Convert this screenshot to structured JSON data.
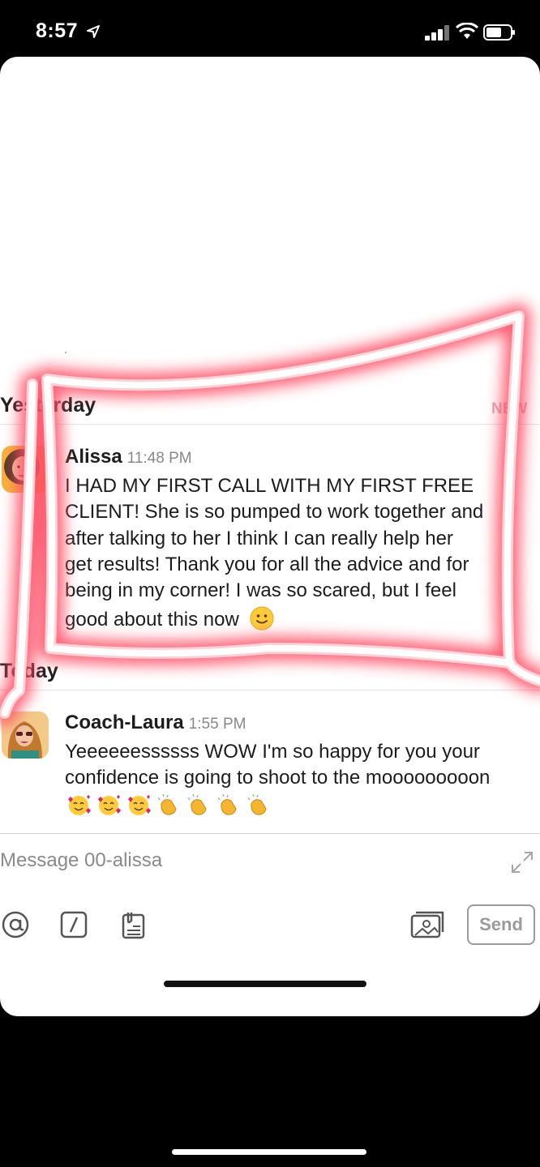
{
  "status_bar": {
    "time": "8:57"
  },
  "conversation": {
    "yesterday_label": "Yesterday",
    "new_label": "NEW",
    "today_label": "Today",
    "messages": [
      {
        "author": "Alissa",
        "time": "11:48 PM",
        "lines": [
          "I HAD MY FIRST CALL WITH MY FIRST FREE",
          "CLIENT! She is so pumped to work together and",
          "after talking to her I think I can really help her",
          "get results! Thank you for all the advice and for",
          "being in my corner! I was so scared, but I feel",
          "good about this now"
        ],
        "emoji": "slightly-smiling-face"
      },
      {
        "author": "Coach-Laura",
        "time": "1:55 PM",
        "lines": [
          "Yeeeeeessssss WOW I'm so happy for you your",
          "confidence is going to shoot to the mooooooooon"
        ],
        "emojis": [
          "smiling-face-with-hearts",
          "smiling-face-with-hearts",
          "smiling-face-with-hearts",
          "clapping-hands",
          "clapping-hands",
          "clapping-hands",
          "clapping-hands"
        ]
      }
    ]
  },
  "composer": {
    "placeholder": "Message 00-alissa",
    "send_label": "Send",
    "icons": [
      "at-icon",
      "slash-command-icon",
      "clipboard-icon",
      "photo-icon",
      "expand-icon"
    ]
  },
  "colors": {
    "accent_glow": "#ff5a6e",
    "divider": "#e8e0e6",
    "name_text": "#1d1c1d"
  }
}
